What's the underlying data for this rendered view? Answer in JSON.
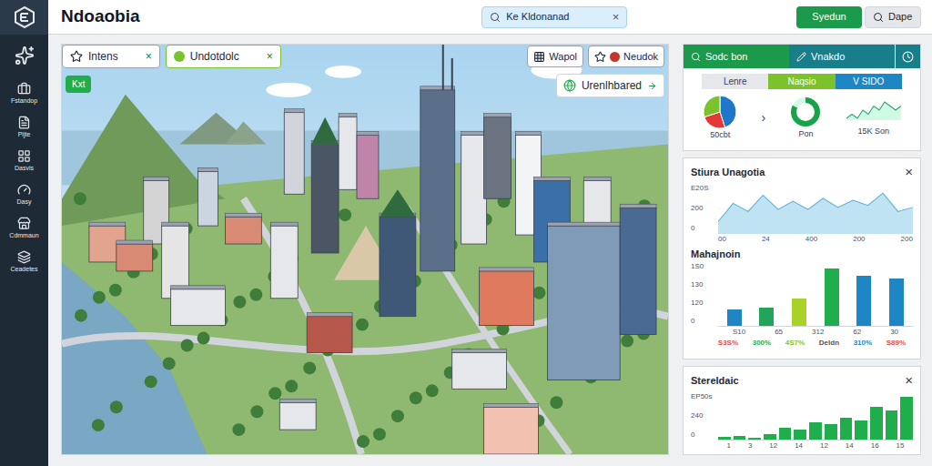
{
  "window": {
    "title": "Ndoaobia"
  },
  "search": {
    "value": "Ke Kldonanad",
    "clear": "×"
  },
  "header_buttons": [
    {
      "label": "Syedun",
      "kind": "primary"
    },
    {
      "label": "Dape",
      "kind": "search"
    }
  ],
  "sidebar": {
    "items": [
      {
        "label": "Fstandop",
        "selected": false
      },
      {
        "label": "Pijte",
        "selected": false
      },
      {
        "label": "Dasvis",
        "selected": false
      },
      {
        "label": "Dasy",
        "selected": false
      },
      {
        "label": "Cdmmaun",
        "selected": false
      },
      {
        "label": "Ceadetes",
        "selected": false
      }
    ]
  },
  "map": {
    "tabs": [
      {
        "label": "Intens",
        "close": "×",
        "selected": true
      },
      {
        "label": "Undotdolc",
        "close": "×",
        "selected": false
      }
    ],
    "tools": [
      {
        "label": "Wapol"
      },
      {
        "label": "Neudok"
      }
    ],
    "badge": "Kxt",
    "layer_button": "Urenlhbared"
  },
  "summary": {
    "tabs": [
      {
        "label": "Sodc bon",
        "selected": true
      },
      {
        "label": "Vnakdo",
        "selected": false
      }
    ],
    "segments": [
      {
        "label": "Lenre",
        "selected": false,
        "color": "#e5e7eb"
      },
      {
        "label": "Naqsio",
        "selected": true,
        "color": "#7cc22b"
      },
      {
        "label": "V SIDO",
        "selected": false,
        "color": "#1f86c6"
      }
    ],
    "pie": {
      "label": "50cbt",
      "slices": [
        {
          "value": 45,
          "color": "#1f77c9"
        },
        {
          "value": 25,
          "color": "#e53935"
        },
        {
          "value": 30,
          "color": "#7cc22b"
        }
      ]
    },
    "arrow": "›",
    "donut": {
      "label": "Pon",
      "level": 0.82
    },
    "sparkline": {
      "label": "15K Son",
      "values": [
        3,
        4,
        3,
        5,
        4,
        6,
        5,
        7,
        6,
        5,
        6
      ]
    }
  },
  "area_card": {
    "title": "Stiura Unagotia",
    "close": "×",
    "y_ticks": [
      "E20S",
      "200",
      "0"
    ],
    "x_ticks": [
      "00",
      "24",
      "400",
      "200",
      "200"
    ],
    "max": 250,
    "values": [
      60,
      150,
      110,
      190,
      120,
      160,
      120,
      175,
      130,
      165,
      140,
      200,
      110,
      130
    ]
  },
  "bar_card": {
    "title": "Mahajnoin",
    "y_ticks": [
      "1S0",
      "130",
      "120",
      "0"
    ],
    "max": 160,
    "bars": [
      {
        "value": 40,
        "color": "#1f86c6"
      },
      {
        "value": 46,
        "color": "#22a55b"
      },
      {
        "value": 68,
        "color": "#a8d12a"
      },
      {
        "value": 142,
        "color": "#1fae4b"
      },
      {
        "value": 125,
        "color": "#1f86c6"
      },
      {
        "value": 118,
        "color": "#1f86c6"
      }
    ],
    "x_ticks": [
      "S10",
      "65",
      "312",
      "62",
      "30"
    ],
    "percents": [
      {
        "label": "S3S%",
        "color": "#d9534f"
      },
      {
        "label": "300%",
        "color": "#1fae4b"
      },
      {
        "label": "4S7%",
        "color": "#8bbf1f"
      },
      {
        "label": "Deldn",
        "color": "#4b5563"
      },
      {
        "label": "310%",
        "color": "#1f86c6"
      },
      {
        "label": "S89%",
        "color": "#d9534f"
      }
    ]
  },
  "steps_card": {
    "title": "Stereldaic",
    "close": "×",
    "y_ticks": [
      "EP50s",
      "240",
      "0"
    ],
    "max": 50,
    "values": [
      3,
      4,
      2,
      6,
      12,
      10,
      18,
      16,
      22,
      20,
      34,
      30,
      44
    ],
    "x_ticks": [
      "1",
      "3",
      "12",
      "14",
      "12",
      "14",
      "16",
      "15"
    ]
  }
}
